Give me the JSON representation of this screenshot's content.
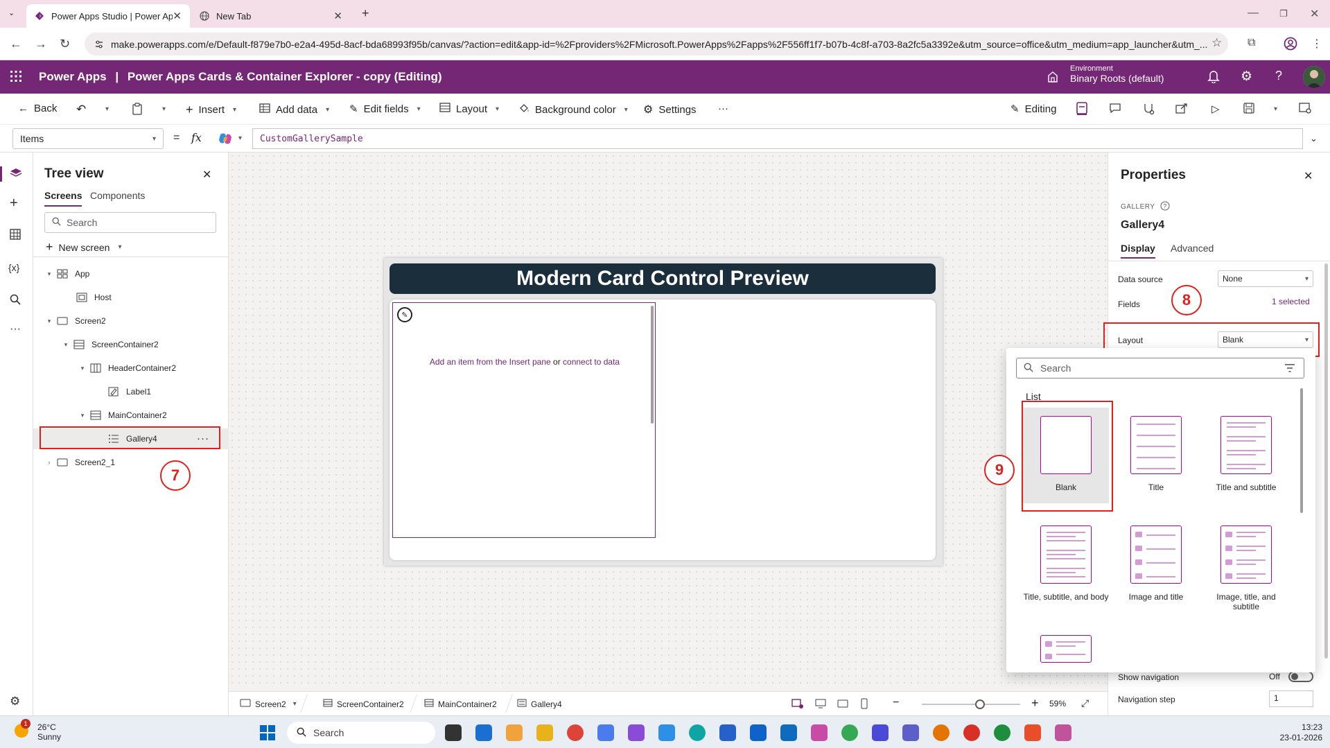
{
  "browser": {
    "tabs": [
      {
        "title": "Power Apps Studio | Power Apps",
        "active": true
      },
      {
        "title": "New Tab",
        "active": false
      }
    ],
    "url": "make.powerapps.com/e/Default-f879e7b0-e2a4-495d-8acf-bda68993f95b/canvas/?action=edit&app-id=%2Fproviders%2FMicrosoft.PowerApps%2Fapps%2F556ff1f7-b07b-4c8f-a703-8a2fc5a3392e&utm_source=office&utm_medium=app_launcher&utm_..."
  },
  "app_header": {
    "product": "Power Apps",
    "separator": "|",
    "app_name": "Power Apps Cards & Container Explorer - copy (Editing)",
    "environment_label": "Environment",
    "environment_name": "Binary Roots (default)",
    "brand_color": "#742774"
  },
  "command_bar": {
    "back": "Back",
    "insert": "Insert",
    "add_data": "Add data",
    "edit_fields": "Edit fields",
    "layout": "Layout",
    "background_color": "Background color",
    "settings": "Settings",
    "more": "···",
    "editing": "Editing"
  },
  "formula_bar": {
    "property": "Items",
    "equals": "=",
    "fx": "fx",
    "formula": "CustomGallerySample"
  },
  "tree_view": {
    "title": "Tree view",
    "tabs": [
      "Screens",
      "Components"
    ],
    "search_placeholder": "Search",
    "new_screen": "New screen",
    "nodes": [
      {
        "label": "App",
        "icon": "app-icon"
      },
      {
        "label": "Host",
        "icon": "host-icon"
      },
      {
        "label": "Screen2",
        "icon": "screen-icon"
      },
      {
        "label": "ScreenContainer2",
        "icon": "vertical-container-icon"
      },
      {
        "label": "HeaderContainer2",
        "icon": "horizontal-container-icon"
      },
      {
        "label": "Label1",
        "icon": "label-icon"
      },
      {
        "label": "MainContainer2",
        "icon": "vertical-container-icon"
      },
      {
        "label": "Gallery4",
        "icon": "gallery-icon",
        "selected": true
      },
      {
        "label": "Screen2_1",
        "icon": "screen-icon"
      }
    ]
  },
  "canvas": {
    "header_text": "Modern Card Control Preview",
    "gallery_hint_prefix": "Add an item from the Insert pane",
    "gallery_hint_or": "or",
    "gallery_hint_link": "connect to data"
  },
  "status_bar": {
    "breadcrumbs": [
      "Screen2",
      "ScreenContainer2",
      "MainContainer2",
      "Gallery4"
    ],
    "zoom_minus": "−",
    "zoom_plus": "+",
    "zoom_level": "59%",
    "zoom_fraction": 0.59
  },
  "properties": {
    "title": "Properties",
    "control_type": "GALLERY",
    "control_name": "Gallery4",
    "tabs": [
      "Display",
      "Advanced"
    ],
    "data_source_label": "Data source",
    "data_source_value": "None",
    "fields_label": "Fields",
    "fields_value": "1 selected",
    "layout_label": "Layout",
    "layout_value": "Blank",
    "show_navigation_label": "Show navigation",
    "show_navigation_value": "Off",
    "navigation_step_label": "Navigation step",
    "navigation_step_value": "1"
  },
  "layout_flyout": {
    "search_placeholder": "Search",
    "section_label": "List",
    "items": [
      {
        "label": "Blank",
        "selected": true
      },
      {
        "label": "Title"
      },
      {
        "label": "Title and subtitle"
      },
      {
        "label": "Title, subtitle, and body"
      },
      {
        "label": "Image and title"
      },
      {
        "label": "Image, title, and subtitle"
      }
    ]
  },
  "annotations": [
    "7",
    "8",
    "9"
  ],
  "taskbar": {
    "temperature": "26°C",
    "condition": "Sunny",
    "weather_badge": "1",
    "search_placeholder": "Search",
    "time": "13:23",
    "date": "23-01-2026"
  }
}
